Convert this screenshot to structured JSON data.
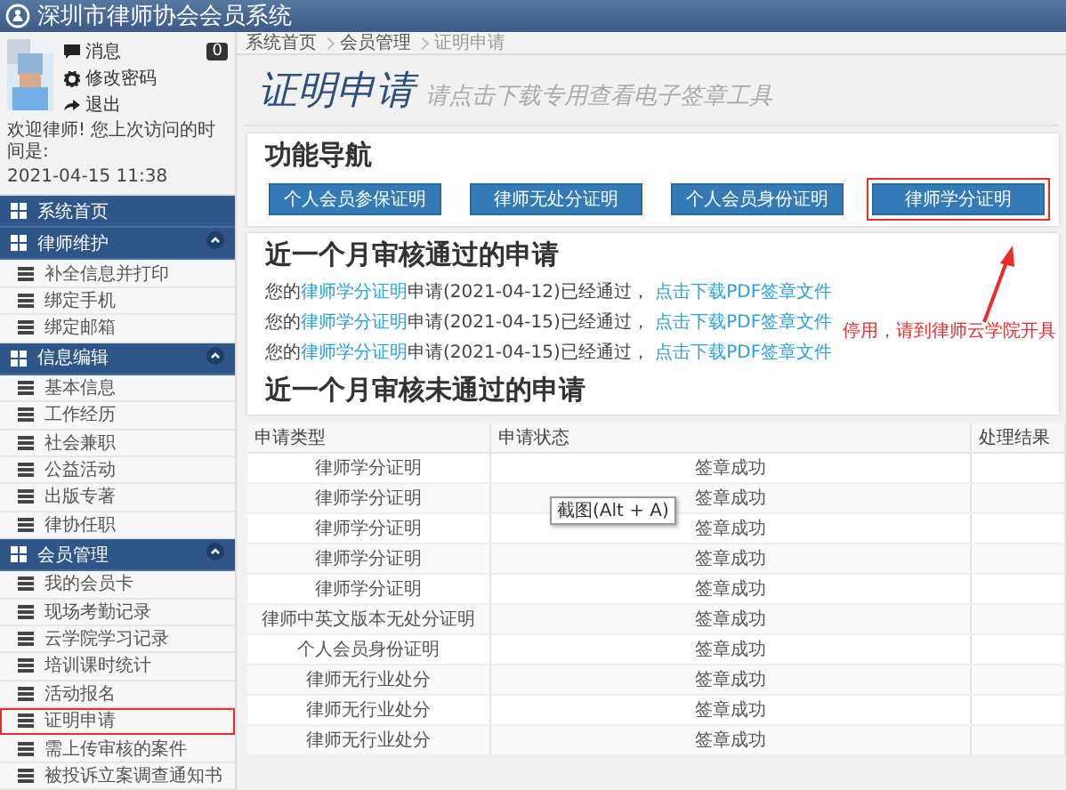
{
  "header": {
    "title": "深圳市律师协会会员系统"
  },
  "user": {
    "menu": [
      {
        "kind": "messages",
        "label": "消息",
        "badge": "0"
      },
      {
        "kind": "password",
        "label": "修改密码"
      },
      {
        "kind": "logout",
        "label": "退出"
      }
    ],
    "welcome": "欢迎律师! 您上次访问的时间是:",
    "last_visit": "2021-04-15 11:38"
  },
  "sidebar": {
    "sections": [
      {
        "kind": "link",
        "label": "系统首页"
      },
      {
        "kind": "group",
        "label": "律师维护",
        "expanded": true,
        "items": [
          {
            "label": "补全信息并打印",
            "annotated": false
          },
          {
            "label": "绑定手机",
            "annotated": false
          },
          {
            "label": "绑定邮箱",
            "annotated": false
          }
        ]
      },
      {
        "kind": "group",
        "label": "信息编辑",
        "expanded": true,
        "items": [
          {
            "label": "基本信息",
            "annotated": false
          },
          {
            "label": "工作经历",
            "annotated": false
          },
          {
            "label": "社会兼职",
            "annotated": false
          },
          {
            "label": "公益活动",
            "annotated": false
          },
          {
            "label": "出版专著",
            "annotated": false
          },
          {
            "label": "律协任职",
            "annotated": false
          }
        ]
      },
      {
        "kind": "group",
        "label": "会员管理",
        "expanded": true,
        "items": [
          {
            "label": "我的会员卡",
            "annotated": false
          },
          {
            "label": "现场考勤记录",
            "annotated": false
          },
          {
            "label": "云学院学习记录",
            "annotated": false
          },
          {
            "label": "培训课时统计",
            "annotated": false
          },
          {
            "label": "活动报名",
            "annotated": false
          },
          {
            "label": "证明申请",
            "annotated": true
          },
          {
            "label": "需上传审核的案件",
            "annotated": false
          },
          {
            "label": "被投诉立案调查通知书",
            "annotated": false
          }
        ]
      }
    ]
  },
  "breadcrumb": [
    "系统首页",
    "会员管理",
    "证明申请"
  ],
  "page": {
    "title": "证明申请",
    "subtitle": "请点击下载专用查看电子签章工具"
  },
  "nav": {
    "title": "功能导航",
    "buttons": [
      {
        "label": "个人会员参保证明",
        "annotated": false
      },
      {
        "label": "律师无处分证明",
        "annotated": false
      },
      {
        "label": "个人会员身份证明",
        "annotated": false
      },
      {
        "label": "律师学分证明",
        "annotated": true
      }
    ]
  },
  "annotation": {
    "text": "停用，请到律师云学院开具"
  },
  "approved": {
    "title": "近一个月审核通过的申请",
    "entries": [
      {
        "prefix": "您的",
        "type": "律师学分证明",
        "status": "申请(2021-04-12)已经通过，",
        "download": "点击下载PDF签章文件"
      },
      {
        "prefix": "您的",
        "type": "律师学分证明",
        "status": "申请(2021-04-15)已经通过，",
        "download": "点击下载PDF签章文件"
      },
      {
        "prefix": "您的",
        "type": "律师学分证明",
        "status": "申请(2021-04-15)已经通过，",
        "download": "点击下载PDF签章文件"
      }
    ]
  },
  "rejected": {
    "title": "近一个月审核未通过的申请"
  },
  "table": {
    "columns": [
      "申请类型",
      "申请状态",
      "处理结果"
    ],
    "rows": [
      {
        "type": "律师学分证明",
        "status": "签章成功"
      },
      {
        "type": "律师学分证明",
        "status": "签章成功"
      },
      {
        "type": "律师学分证明",
        "status": "签章成功"
      },
      {
        "type": "律师学分证明",
        "status": "签章成功"
      },
      {
        "type": "律师学分证明",
        "status": "签章成功"
      },
      {
        "type": "律师中英文版本无处分证明",
        "status": "签章成功"
      },
      {
        "type": "个人会员身份证明",
        "status": "签章成功"
      },
      {
        "type": "律师无行业处分",
        "status": "签章成功"
      },
      {
        "type": "律师无行业处分",
        "status": "签章成功"
      },
      {
        "type": "律师无行业处分",
        "status": "签章成功"
      }
    ]
  },
  "tooltip": {
    "text": "截图(Alt + A)"
  }
}
